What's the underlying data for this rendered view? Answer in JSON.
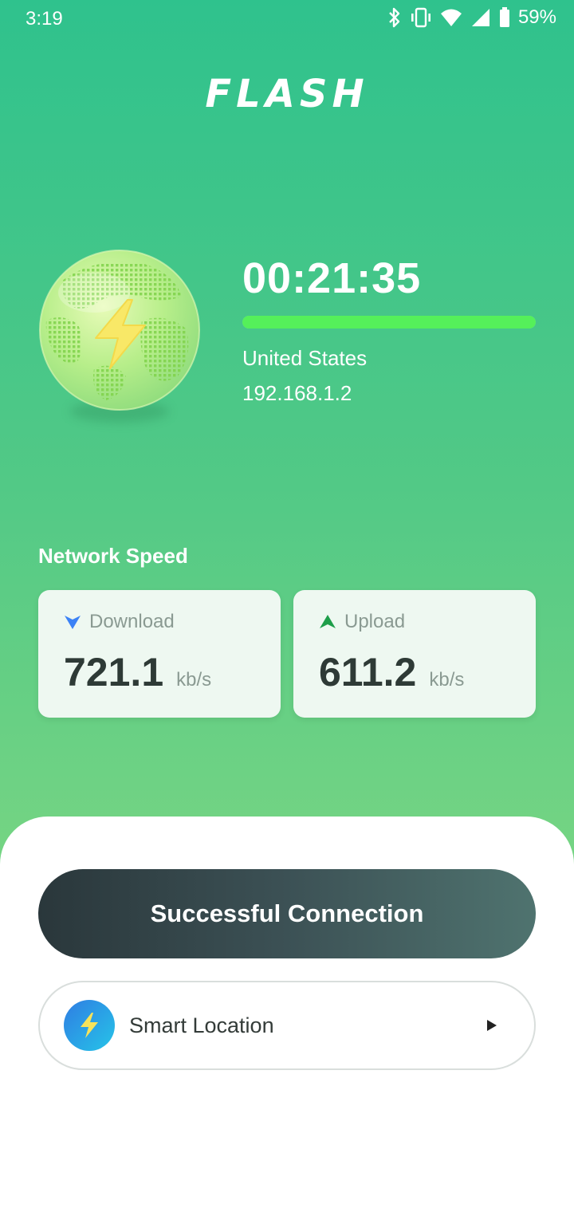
{
  "status_bar": {
    "time": "3:19",
    "battery_percent": "59%",
    "icons": [
      "bluetooth-icon",
      "vibrate-icon",
      "wifi-icon",
      "cell-signal-icon",
      "battery-icon"
    ]
  },
  "app": {
    "logo": "FLASH"
  },
  "connection": {
    "timer": "00:21:35",
    "progress": 1.0,
    "country": "United States",
    "ip": "192.168.1.2"
  },
  "network_speed": {
    "heading": "Network Speed",
    "download": {
      "label": "Download",
      "value": "721.1",
      "unit": "kb/s",
      "icon": "download-arrow-icon",
      "color": "#3b82f6"
    },
    "upload": {
      "label": "Upload",
      "value": "611.2",
      "unit": "kb/s",
      "icon": "upload-arrow-icon",
      "color": "#1e9e4a"
    }
  },
  "actions": {
    "connect_button_label": "Successful Connection",
    "location_label": "Smart Location"
  },
  "colors": {
    "accent_green": "#55f05a",
    "button_dark": "#2a373b"
  }
}
